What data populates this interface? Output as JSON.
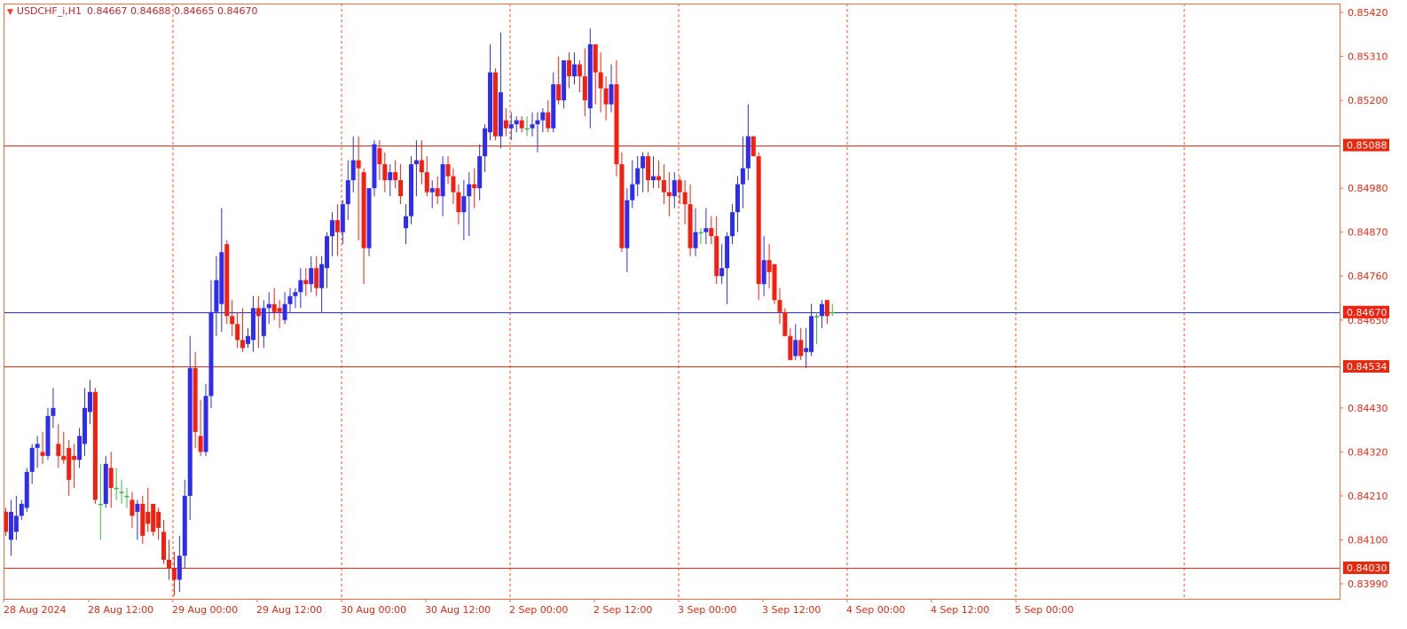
{
  "header": {
    "symbol": "USDCHF_i,H1",
    "ohlc": "0.84667 0.84688 0.84665 0.84670"
  },
  "colors": {
    "background": "#ffffff",
    "frame": "#ff6a3d",
    "grid": "#ff4e17",
    "bull": "#2d2df2",
    "bear": "#f41f0e",
    "doji": "#3bb84a",
    "hline": "#e8280f",
    "bidline": "#2a2ae8",
    "axis_text": "#e8280f"
  },
  "chart_data": {
    "type": "candlestick",
    "title": "USDCHF_i,H1",
    "ylim": [
      0.8393,
      0.8543
    ],
    "yticks": [
      "0.85420",
      "0.85310",
      "0.85200",
      "0.84980",
      "0.84870",
      "0.84760",
      "0.84650",
      "0.84430",
      "0.84320",
      "0.84210",
      "0.84100",
      "0.83990"
    ],
    "xticks": [
      "28 Aug 2024",
      "28 Aug 12:00",
      "29 Aug 00:00",
      "29 Aug 12:00",
      "30 Aug 00:00",
      "30 Aug 12:00",
      "2 Sep 00:00",
      "2 Sep 12:00",
      "3 Sep 00:00",
      "3 Sep 12:00",
      "4 Sep 00:00",
      "4 Sep 12:00",
      "5 Sep 00:00"
    ],
    "horizontal_lines": [
      {
        "label": "0.85088",
        "value": 0.85088,
        "kind": "level"
      },
      {
        "label": "0.84534",
        "value": 0.84534,
        "kind": "level"
      },
      {
        "label": "0.84030",
        "value": 0.8403,
        "kind": "level"
      },
      {
        "label": "0.84670",
        "value": 0.8467,
        "kind": "bid"
      }
    ],
    "candles": [
      [
        0.8417,
        0.8418,
        0.8411,
        0.8412
      ],
      [
        0.841,
        0.842,
        0.8406,
        0.8417
      ],
      [
        0.8412,
        0.8421,
        0.841,
        0.8416
      ],
      [
        0.8416,
        0.842,
        0.8415,
        0.8419
      ],
      [
        0.8418,
        0.8428,
        0.8417,
        0.8427
      ],
      [
        0.8427,
        0.8434,
        0.8424,
        0.8433
      ],
      [
        0.8433,
        0.8436,
        0.8428,
        0.8434
      ],
      [
        0.8432,
        0.8437,
        0.8429,
        0.8431
      ],
      [
        0.8431,
        0.8443,
        0.843,
        0.8441
      ],
      [
        0.8441,
        0.8448,
        0.8438,
        0.8443
      ],
      [
        0.8434,
        0.8439,
        0.8428,
        0.8431
      ],
      [
        0.8431,
        0.8437,
        0.8429,
        0.843
      ],
      [
        0.8433,
        0.8435,
        0.8421,
        0.8425
      ],
      [
        0.8431,
        0.8434,
        0.8423,
        0.843
      ],
      [
        0.843,
        0.8438,
        0.8428,
        0.8436
      ],
      [
        0.8434,
        0.8448,
        0.8431,
        0.8443
      ],
      [
        0.8442,
        0.845,
        0.8439,
        0.8447
      ],
      [
        0.8447,
        0.8448,
        0.8419,
        0.842
      ],
      [
        0.8419,
        0.8429,
        0.841,
        0.8419
      ],
      [
        0.8419,
        0.8431,
        0.8418,
        0.8429
      ],
      [
        0.8428,
        0.8432,
        0.8418,
        0.8423
      ],
      [
        0.8423,
        0.8428,
        0.842,
        0.8423
      ],
      [
        0.8422,
        0.8425,
        0.8419,
        0.8422
      ],
      [
        0.8421,
        0.8423,
        0.8418,
        0.8421
      ],
      [
        0.842,
        0.8422,
        0.8413,
        0.8416
      ],
      [
        0.8417,
        0.842,
        0.841,
        0.8419
      ],
      [
        0.8419,
        0.8421,
        0.8409,
        0.8411
      ],
      [
        0.8417,
        0.8423,
        0.8412,
        0.8414
      ],
      [
        0.8419,
        0.8419,
        0.8411,
        0.8412
      ],
      [
        0.8417,
        0.8418,
        0.841,
        0.8413
      ],
      [
        0.8412,
        0.8415,
        0.8404,
        0.8405
      ],
      [
        0.8405,
        0.841,
        0.84,
        0.8403
      ],
      [
        0.8403,
        0.8407,
        0.8396,
        0.84
      ],
      [
        0.84,
        0.8411,
        0.8397,
        0.8406
      ],
      [
        0.8406,
        0.8425,
        0.8403,
        0.8421
      ],
      [
        0.8421,
        0.8461,
        0.8415,
        0.8453
      ],
      [
        0.8453,
        0.8457,
        0.8433,
        0.8437
      ],
      [
        0.8436,
        0.8445,
        0.8431,
        0.8432
      ],
      [
        0.8432,
        0.8449,
        0.8431,
        0.8446
      ],
      [
        0.8446,
        0.8475,
        0.8443,
        0.8467
      ],
      [
        0.8467,
        0.8481,
        0.8461,
        0.8475
      ],
      [
        0.8469,
        0.8493,
        0.8462,
        0.8482
      ],
      [
        0.8484,
        0.8485,
        0.8464,
        0.8466
      ],
      [
        0.8466,
        0.847,
        0.8461,
        0.8464
      ],
      [
        0.8464,
        0.8467,
        0.8458,
        0.846
      ],
      [
        0.846,
        0.8468,
        0.8457,
        0.8458
      ],
      [
        0.8459,
        0.8463,
        0.8458,
        0.8461
      ],
      [
        0.846,
        0.8471,
        0.8457,
        0.8468
      ],
      [
        0.8468,
        0.8471,
        0.8458,
        0.8466
      ],
      [
        0.8461,
        0.847,
        0.8458,
        0.8468
      ],
      [
        0.8468,
        0.8472,
        0.8464,
        0.8469
      ],
      [
        0.8469,
        0.8473,
        0.8465,
        0.8467
      ],
      [
        0.8468,
        0.847,
        0.8463,
        0.8467
      ],
      [
        0.8465,
        0.8472,
        0.8464,
        0.8469
      ],
      [
        0.8469,
        0.8473,
        0.8467,
        0.8471
      ],
      [
        0.8471,
        0.8473,
        0.8468,
        0.8472
      ],
      [
        0.8472,
        0.8478,
        0.8468,
        0.8475
      ],
      [
        0.8475,
        0.8478,
        0.8471,
        0.8474
      ],
      [
        0.8474,
        0.8481,
        0.8472,
        0.8478
      ],
      [
        0.8478,
        0.8481,
        0.8471,
        0.8473
      ],
      [
        0.8473,
        0.8481,
        0.8467,
        0.8479
      ],
      [
        0.8478,
        0.8487,
        0.8473,
        0.8486
      ],
      [
        0.8486,
        0.8492,
        0.8481,
        0.849
      ],
      [
        0.849,
        0.8494,
        0.8481,
        0.8487
      ],
      [
        0.8487,
        0.8495,
        0.8484,
        0.8494
      ],
      [
        0.8494,
        0.8505,
        0.849,
        0.85
      ],
      [
        0.85,
        0.8511,
        0.8497,
        0.8505
      ],
      [
        0.8505,
        0.8511,
        0.8485,
        0.8503
      ],
      [
        0.8502,
        0.8503,
        0.8474,
        0.8483
      ],
      [
        0.8483,
        0.8498,
        0.8481,
        0.8498
      ],
      [
        0.8498,
        0.851,
        0.8496,
        0.8509
      ],
      [
        0.8508,
        0.851,
        0.85,
        0.8504
      ],
      [
        0.8504,
        0.8507,
        0.8497,
        0.85
      ],
      [
        0.85,
        0.8504,
        0.8496,
        0.8502
      ],
      [
        0.8502,
        0.8505,
        0.8498,
        0.85
      ],
      [
        0.85,
        0.8504,
        0.8494,
        0.8496
      ],
      [
        0.8488,
        0.8494,
        0.8484,
        0.8491
      ],
      [
        0.8491,
        0.8506,
        0.8489,
        0.8504
      ],
      [
        0.8504,
        0.851,
        0.8496,
        0.8505
      ],
      [
        0.8505,
        0.851,
        0.8499,
        0.8502
      ],
      [
        0.8502,
        0.8506,
        0.8496,
        0.8497
      ],
      [
        0.8497,
        0.85,
        0.8493,
        0.8498
      ],
      [
        0.8498,
        0.8501,
        0.8494,
        0.8496
      ],
      [
        0.8496,
        0.8506,
        0.8491,
        0.8504
      ],
      [
        0.8504,
        0.8506,
        0.8499,
        0.8501
      ],
      [
        0.8501,
        0.8503,
        0.8494,
        0.8497
      ],
      [
        0.8497,
        0.8499,
        0.8489,
        0.8492
      ],
      [
        0.8492,
        0.85,
        0.8485,
        0.8496
      ],
      [
        0.8496,
        0.8502,
        0.8486,
        0.8499
      ],
      [
        0.8499,
        0.8503,
        0.8493,
        0.8498
      ],
      [
        0.8498,
        0.8509,
        0.8495,
        0.8506
      ],
      [
        0.8506,
        0.8514,
        0.8502,
        0.8513
      ],
      [
        0.8512,
        0.8534,
        0.851,
        0.8527
      ],
      [
        0.8527,
        0.8528,
        0.851,
        0.8511
      ],
      [
        0.8511,
        0.8537,
        0.8508,
        0.8522
      ],
      [
        0.8515,
        0.8518,
        0.8511,
        0.8513
      ],
      [
        0.8513,
        0.8517,
        0.851,
        0.8514
      ],
      [
        0.8514,
        0.8516,
        0.8512,
        0.8515
      ],
      [
        0.8515,
        0.8516,
        0.8512,
        0.8513
      ],
      [
        0.8513,
        0.8516,
        0.8511,
        0.8513
      ],
      [
        0.8513,
        0.8517,
        0.8511,
        0.8514
      ],
      [
        0.8514,
        0.8517,
        0.8507,
        0.8515
      ],
      [
        0.8515,
        0.8518,
        0.8512,
        0.8517
      ],
      [
        0.8517,
        0.852,
        0.8512,
        0.8513
      ],
      [
        0.8513,
        0.8527,
        0.8512,
        0.8524
      ],
      [
        0.8524,
        0.8531,
        0.8519,
        0.852
      ],
      [
        0.852,
        0.853,
        0.8518,
        0.853
      ],
      [
        0.853,
        0.8532,
        0.8523,
        0.8526
      ],
      [
        0.8526,
        0.8532,
        0.8524,
        0.8529
      ],
      [
        0.8529,
        0.853,
        0.8522,
        0.8526
      ],
      [
        0.8526,
        0.8533,
        0.8516,
        0.852
      ],
      [
        0.8518,
        0.8538,
        0.8513,
        0.8534
      ],
      [
        0.8534,
        0.8534,
        0.8519,
        0.8527
      ],
      [
        0.8527,
        0.8532,
        0.8517,
        0.8523
      ],
      [
        0.8523,
        0.8526,
        0.8515,
        0.8519
      ],
      [
        0.8519,
        0.8529,
        0.8517,
        0.8524
      ],
      [
        0.8524,
        0.853,
        0.8501,
        0.8504
      ],
      [
        0.8504,
        0.8507,
        0.8482,
        0.8483
      ],
      [
        0.8483,
        0.8498,
        0.8477,
        0.8495
      ],
      [
        0.8495,
        0.8505,
        0.8493,
        0.8499
      ],
      [
        0.8499,
        0.8506,
        0.8496,
        0.8503
      ],
      [
        0.8503,
        0.8507,
        0.8497,
        0.8506
      ],
      [
        0.8506,
        0.8507,
        0.8497,
        0.85
      ],
      [
        0.85,
        0.8506,
        0.8498,
        0.8501
      ],
      [
        0.8501,
        0.8505,
        0.8498,
        0.85
      ],
      [
        0.85,
        0.8504,
        0.8494,
        0.8497
      ],
      [
        0.8497,
        0.8502,
        0.8491,
        0.8496
      ],
      [
        0.8496,
        0.8502,
        0.8493,
        0.85
      ],
      [
        0.85,
        0.8501,
        0.8494,
        0.8497
      ],
      [
        0.8497,
        0.85,
        0.8489,
        0.8494
      ],
      [
        0.8494,
        0.8499,
        0.8481,
        0.8483
      ],
      [
        0.8483,
        0.8493,
        0.8481,
        0.8487
      ],
      [
        0.8487,
        0.8488,
        0.8484,
        0.8487
      ],
      [
        0.8487,
        0.8493,
        0.8484,
        0.8488
      ],
      [
        0.8488,
        0.8491,
        0.8484,
        0.8486
      ],
      [
        0.8486,
        0.8491,
        0.8474,
        0.8476
      ],
      [
        0.8476,
        0.8484,
        0.8474,
        0.8478
      ],
      [
        0.8478,
        0.8487,
        0.8469,
        0.8486
      ],
      [
        0.8486,
        0.8494,
        0.8484,
        0.8492
      ],
      [
        0.8492,
        0.8501,
        0.8487,
        0.8499
      ],
      [
        0.8499,
        0.8511,
        0.8493,
        0.8503
      ],
      [
        0.8503,
        0.8519,
        0.85,
        0.8511
      ],
      [
        0.8511,
        0.8511,
        0.8506,
        0.8506
      ],
      [
        0.8506,
        0.8507,
        0.847,
        0.8474
      ],
      [
        0.8474,
        0.8486,
        0.8471,
        0.848
      ],
      [
        0.848,
        0.8484,
        0.8473,
        0.8477
      ],
      [
        0.8479,
        0.8479,
        0.8469,
        0.847
      ],
      [
        0.847,
        0.8473,
        0.8464,
        0.8467
      ],
      [
        0.8467,
        0.8468,
        0.8461,
        0.8461
      ],
      [
        0.8461,
        0.8463,
        0.8455,
        0.8455
      ],
      [
        0.8456,
        0.8464,
        0.8455,
        0.846
      ],
      [
        0.846,
        0.8463,
        0.8455,
        0.8456
      ],
      [
        0.8457,
        0.8463,
        0.8453,
        0.8458
      ],
      [
        0.8457,
        0.8469,
        0.8456,
        0.8466
      ],
      [
        0.8466,
        0.8467,
        0.8459,
        0.8466
      ],
      [
        0.8466,
        0.847,
        0.8463,
        0.8469
      ],
      [
        0.847,
        0.847,
        0.8464,
        0.8466
      ],
      [
        0.8467,
        0.8469,
        0.8466,
        0.8467
      ]
    ]
  }
}
